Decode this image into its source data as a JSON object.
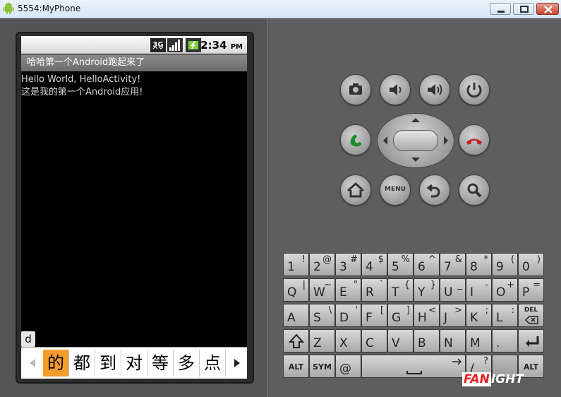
{
  "window": {
    "title": "5554:MyPhone"
  },
  "statusbar": {
    "network": "3G",
    "time": "2:34",
    "ampm": "PM"
  },
  "app": {
    "title": "哈哈第一个Android跑起来了"
  },
  "content": {
    "line1": "Hello World, HelloActivity!",
    "line2": "这是我的第一个Android应用!"
  },
  "ime": {
    "typed": "d",
    "candidates": [
      "的",
      "都",
      "到",
      "对",
      "等",
      "多",
      "点"
    ],
    "selected_index": 0
  },
  "controls": {
    "menu_label": "MENU"
  },
  "keyboard": {
    "row1": [
      [
        "1",
        "!"
      ],
      [
        "2",
        "@"
      ],
      [
        "3",
        "#"
      ],
      [
        "4",
        "$"
      ],
      [
        "5",
        "%"
      ],
      [
        "6",
        "^"
      ],
      [
        "7",
        "&"
      ],
      [
        "8",
        "*"
      ],
      [
        "9",
        "("
      ],
      [
        "0",
        ")"
      ]
    ],
    "row2": [
      [
        "Q",
        "|"
      ],
      [
        "W",
        "~"
      ],
      [
        "E",
        "\""
      ],
      [
        "R",
        "`"
      ],
      [
        "T",
        "{"
      ],
      [
        "Y",
        "}"
      ],
      [
        "U",
        "_"
      ],
      [
        "I",
        "-"
      ],
      [
        "O",
        "+"
      ],
      [
        "P",
        "="
      ]
    ],
    "row3": [
      [
        "A",
        ""
      ],
      [
        "S",
        "\\"
      ],
      [
        "D",
        "'"
      ],
      [
        "F",
        "["
      ],
      [
        "G",
        "]"
      ],
      [
        "H",
        "<"
      ],
      [
        "J",
        ">"
      ],
      [
        "K",
        ";"
      ],
      [
        "L",
        ":"
      ]
    ],
    "row4": [
      [
        "Z",
        ""
      ],
      [
        "X",
        ""
      ],
      [
        "C",
        ""
      ],
      [
        "V",
        ""
      ],
      [
        "B",
        ""
      ],
      [
        "N",
        ""
      ],
      [
        "M",
        ""
      ],
      [
        ".",
        ""
      ]
    ],
    "alt_label": "ALT",
    "sym_label": "SYM",
    "at_label": "@",
    "del_label": "DEL",
    "question": "?",
    "slash": "/",
    "alt_right_label": "ALT"
  },
  "watermark": {
    "brand_a": "FAN",
    "brand_b": "IGHT"
  }
}
